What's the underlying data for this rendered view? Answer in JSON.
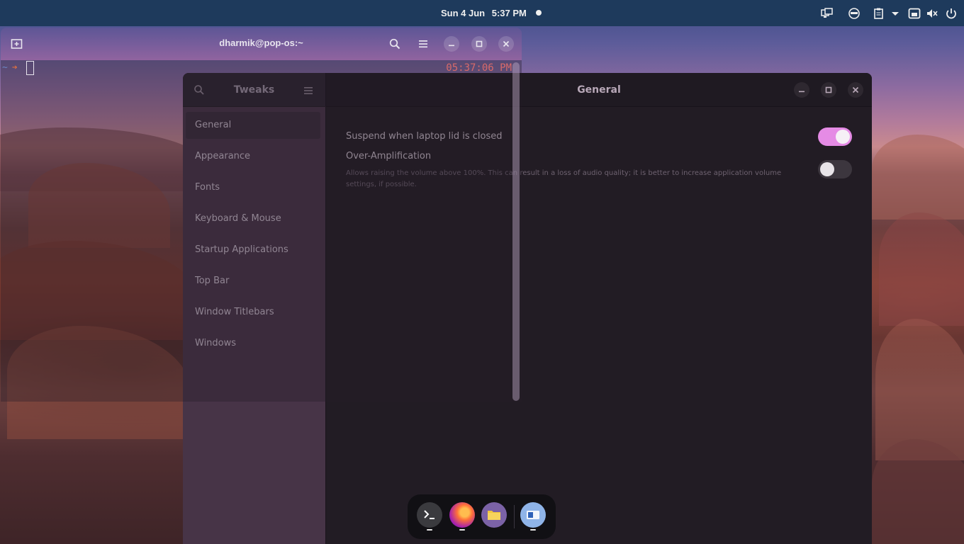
{
  "topbar": {
    "date": "Sun 4 Jun",
    "time": "5:37 PM",
    "tray_icons": [
      "display-switch-icon",
      "face-icon",
      "clipboard-icon",
      "chevron-down-icon",
      "network-icon",
      "volume-muted-icon",
      "power-icon"
    ]
  },
  "terminal": {
    "title": "dharmik@pop-os:~",
    "prompt_dir": "~",
    "prompt_clock": "05:37:06 PM",
    "buttons": [
      "new-tab-icon",
      "search-icon",
      "menu-icon",
      "minimize-icon",
      "maximize-icon",
      "close-icon"
    ]
  },
  "tweaks": {
    "sidebar_title": "Tweaks",
    "page_title": "General",
    "sidebar": {
      "items": [
        {
          "label": "General",
          "active": true
        },
        {
          "label": "Appearance"
        },
        {
          "label": "Fonts"
        },
        {
          "label": "Keyboard & Mouse"
        },
        {
          "label": "Startup Applications"
        },
        {
          "label": "Top Bar"
        },
        {
          "label": "Window Titlebars"
        },
        {
          "label": "Windows"
        }
      ]
    },
    "settings": [
      {
        "label": "Suspend when laptop lid is closed",
        "enabled": true
      },
      {
        "label": "Over-Amplification",
        "description": "Allows raising the volume above 100%. This can result in a loss of audio quality; it is better to increase application volume settings, if possible.",
        "enabled": false
      }
    ]
  },
  "dock": {
    "apps": [
      "terminal-icon",
      "firefox-icon",
      "files-icon",
      "tweaks-icon"
    ]
  },
  "colors": {
    "topbar": "#1e3a5c",
    "accent_toggle": "#e58be5",
    "sidebar": "#473447",
    "content": "#221c24"
  }
}
